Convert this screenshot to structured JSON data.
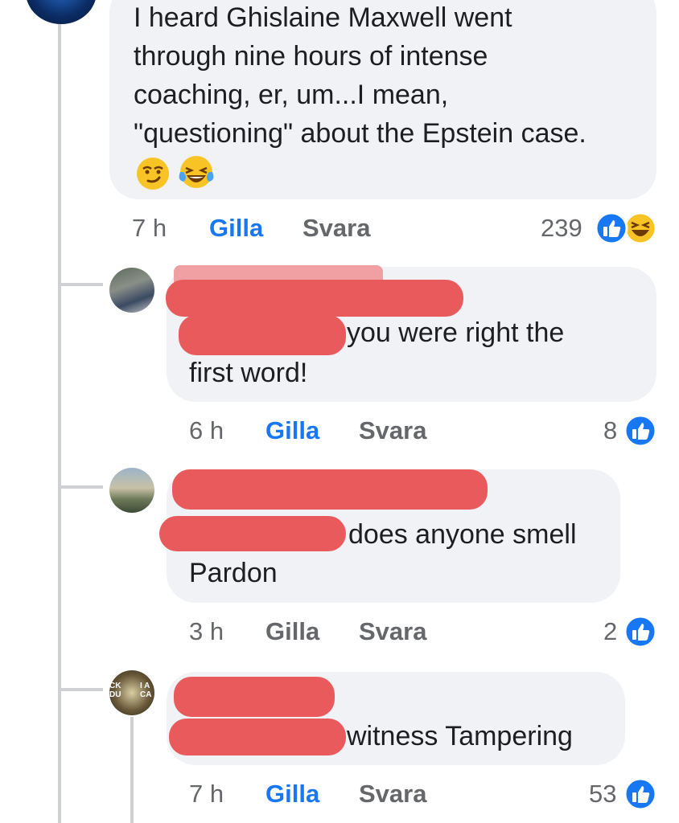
{
  "main_comment": {
    "lines": [
      "I heard Ghislaine Maxwell went",
      "through nine hours of intense",
      "coaching, er, um...I mean,",
      "\"questioning\" about the Epstein case."
    ],
    "emojis": [
      "smirk-emoji",
      "laughing-tears-emoji"
    ],
    "time": "7 h",
    "like_label": "Gilla",
    "reply_label": "Svara",
    "reaction_count": "239",
    "reactions": [
      "like-icon",
      "haha-icon"
    ]
  },
  "replies": [
    {
      "text_line1": "you were right the",
      "text_line2": "first word!",
      "time": "6 h",
      "like_label": "Gilla",
      "reply_label": "Svara",
      "reaction_count": "8",
      "like_active": true
    },
    {
      "text_line1": "does anyone smell",
      "text_line2": "Pardon",
      "time": "3 h",
      "like_label": "Gilla",
      "reply_label": "Svara",
      "reaction_count": "2",
      "like_active": false
    },
    {
      "text_line1": "witness Tampering",
      "time": "7 h",
      "like_label": "Gilla",
      "reply_label": "Svara",
      "reaction_count": "53",
      "like_active": true,
      "avatar_text_left": "CK\nDU",
      "avatar_text_right": "I A\nCA"
    }
  ],
  "colors": {
    "like_blue": "#1877f2",
    "meta_gray": "#65676b",
    "bubble_bg": "#f0f2f5",
    "redaction": "#e85a5c"
  }
}
